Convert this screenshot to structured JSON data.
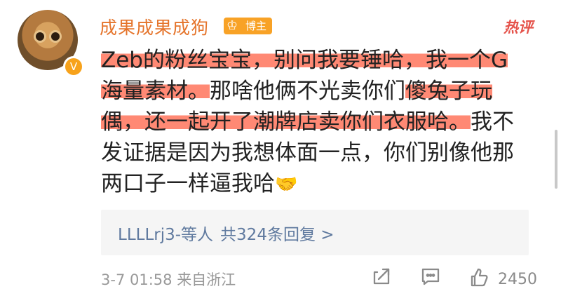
{
  "comment": {
    "author": "成果成果成狗",
    "badge_label": "博主",
    "verify_icon": "v-verified-icon",
    "hot_label": "热评",
    "text_segments": [
      {
        "text": "Zeb的粉丝宝宝，别问我要锤哈，我一个G海量素材。",
        "highlight": true
      },
      {
        "text": "那啥他俩不光卖你们",
        "highlight": false
      },
      {
        "text": "傻兔子玩偶，还一起开了潮牌店卖你们衣服哈。",
        "highlight": true
      },
      {
        "text": "我不发证据是因为我想体面一点，你们别像他那两口子一样逼我哈",
        "highlight": false
      }
    ],
    "emoji": "🤝",
    "replies_text": "LLLLrj3-等人",
    "replies_count_text": "共324条回复 >",
    "timestamp": "3-7 01:58",
    "location": "来自浙江",
    "likes": "2450",
    "icons": [
      "share-icon",
      "comment-icon",
      "like-icon"
    ]
  }
}
